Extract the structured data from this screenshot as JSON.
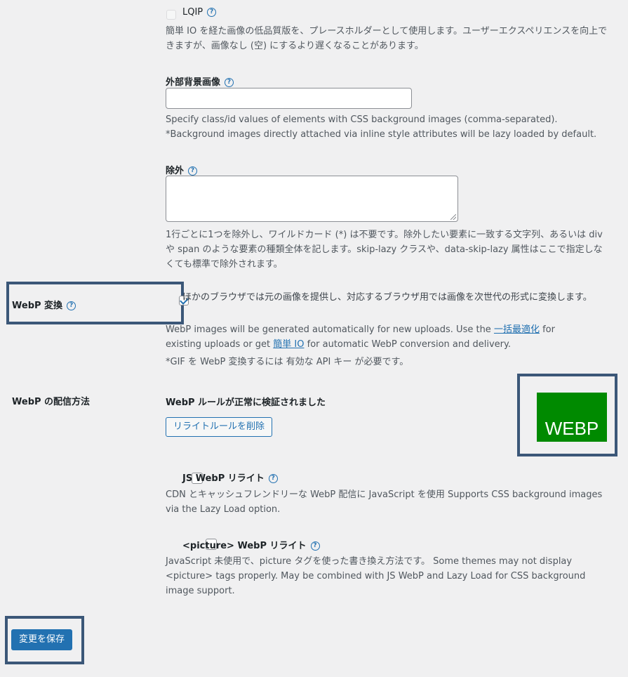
{
  "lqip": {
    "label": "LQIP",
    "desc": "簡単 IO を経た画像の低品質版を、プレースホルダーとして使用します。ユーザーエクスペリエンスを向上できますが、画像なし (空) にするより遅くなることがあります。"
  },
  "external_bg": {
    "label": "外部背景画像",
    "value": "",
    "desc1": "Specify class/id values of elements with CSS background images (comma-separated).",
    "desc2": "*Background images directly attached via inline style attributes will be lazy loaded by default."
  },
  "exclude": {
    "label": "除外",
    "value": "",
    "desc": "1行ごとに1つを除外し、ワイルドカード (*) は不要です。除外したい要素に一致する文字列、あるいは div や span のような要素の種類全体を記します。skip-lazy クラスや、data-skip-lazy 属性はここで指定しなくても標準で除外されます。"
  },
  "webp_convert": {
    "label": "WebP 変換",
    "checkbox_text": "ほかのブラウザでは元の画像を提供し、対応するブラウザ用では画像を次世代の形式に変換します。",
    "desc_a": "WebP images will be generated automatically for new uploads. Use the ",
    "link1": "一括最適化",
    "desc_b": " for existing uploads or get ",
    "link2": "簡単 IO",
    "desc_c": " for automatic WebP conversion and delivery.",
    "note": "*GIF を WebP 変換するには 有効な API キー が必要です。"
  },
  "webp_delivery": {
    "label": "WebP の配信方法",
    "status": "WebP ルールが正常に検証されました",
    "remove_button": "リライトルールを削除",
    "badge": "WEBP",
    "badge_color": "#008a00"
  },
  "js_webp": {
    "label": "JS WebP リライト",
    "desc": "CDN とキャッシュフレンドリーな WebP 配信に JavaScript を使用 Supports CSS background images via the Lazy Load option."
  },
  "picture_webp": {
    "label": "<picture> WebP リライト",
    "desc": "JavaScript 未使用で、picture タグを使った書き換え方法です。 Some themes may not display <picture> tags properly. May be combined with JS WebP and Lazy Load for CSS background image support."
  },
  "save_button": "変更を保存",
  "help_glyph": "?",
  "accent": "#2271b1",
  "highlight_color": "#3b5778"
}
